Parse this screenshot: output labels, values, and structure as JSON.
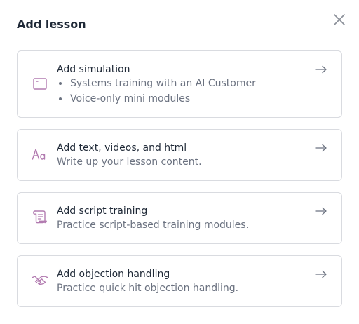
{
  "modal": {
    "title": "Add lesson"
  },
  "colors": {
    "icon_accent": "#b27bb0",
    "arrow": "#6b7280"
  },
  "options": [
    {
      "icon": "simulation-window-icon",
      "title": "Add simulation",
      "bullets": [
        "Systems training with an AI Customer",
        "Voice-only mini modules"
      ]
    },
    {
      "icon": "text-aa-icon",
      "title": "Add text, videos, and html",
      "description": "Write up your lesson content."
    },
    {
      "icon": "script-scroll-icon",
      "title": "Add script training",
      "description": "Practice script-based training modules."
    },
    {
      "icon": "handshake-icon",
      "title": "Add objection handling",
      "description": "Practice quick hit objection handling."
    }
  ]
}
